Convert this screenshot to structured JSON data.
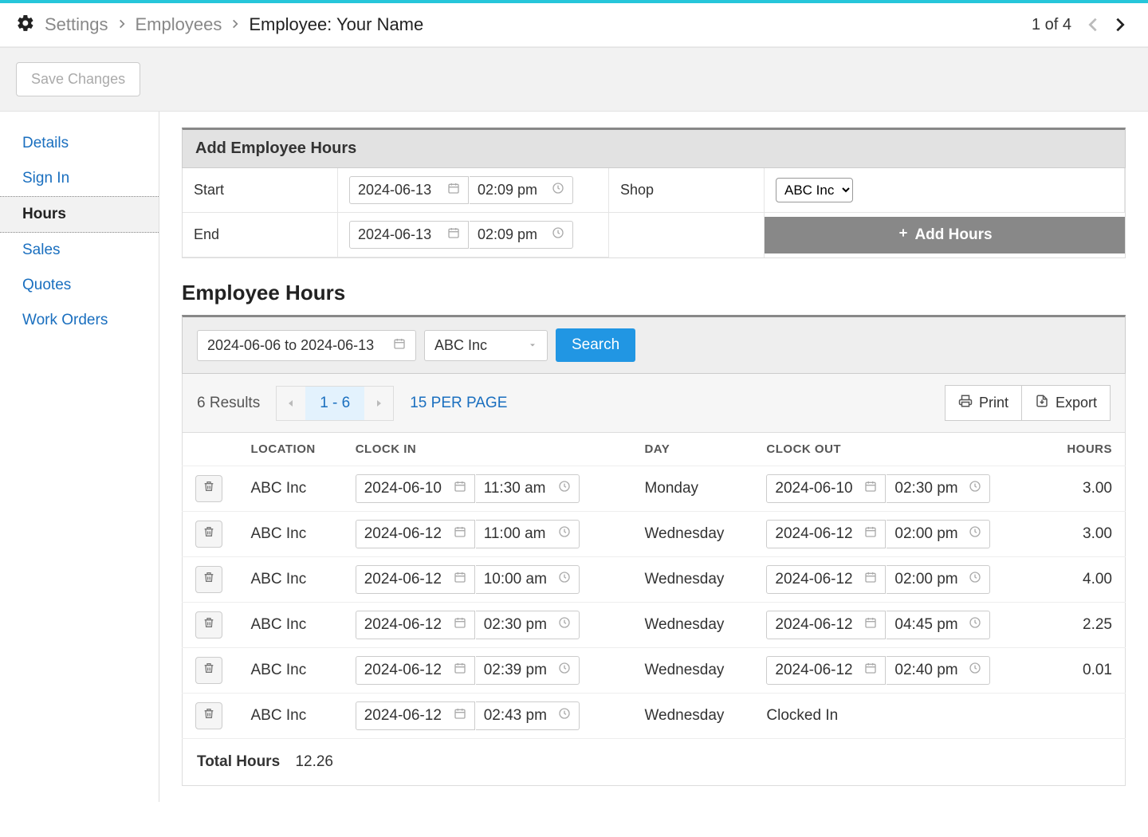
{
  "breadcrumb": {
    "level1": "Settings",
    "level2": "Employees",
    "level3": "Employee:  Your Name",
    "pager": "1 of 4"
  },
  "actions": {
    "save": "Save Changes"
  },
  "sidebar": {
    "items": [
      {
        "label": "Details"
      },
      {
        "label": "Sign In"
      },
      {
        "label": "Hours"
      },
      {
        "label": "Sales"
      },
      {
        "label": "Quotes"
      },
      {
        "label": "Work Orders"
      }
    ]
  },
  "addHours": {
    "title": "Add Employee Hours",
    "startLabel": "Start",
    "endLabel": "End",
    "startDate": "2024-06-13",
    "startTime": "02:09 pm",
    "endDate": "2024-06-13",
    "endTime": "02:09 pm",
    "shopLabel": "Shop",
    "shopValue": "ABC Inc",
    "addButton": "Add Hours"
  },
  "listing": {
    "heading": "Employee Hours",
    "filterDateRange": "2024-06-06 to 2024-06-13",
    "filterShop": "ABC Inc",
    "searchLabel": "Search",
    "resultsCount": "6 Results",
    "pageRange": "1 - 6",
    "perPage": "15 PER PAGE",
    "printLabel": "Print",
    "exportLabel": "Export",
    "columns": {
      "location": "LOCATION",
      "clockin": "CLOCK IN",
      "day": "DAY",
      "clockout": "CLOCK OUT",
      "hours": "HOURS"
    },
    "rows": [
      {
        "location": "ABC Inc",
        "inDate": "2024-06-10",
        "inTime": "11:30 am",
        "day": "Monday",
        "outDate": "2024-06-10",
        "outTime": "02:30 pm",
        "hours": "3.00"
      },
      {
        "location": "ABC Inc",
        "inDate": "2024-06-12",
        "inTime": "11:00 am",
        "day": "Wednesday",
        "outDate": "2024-06-12",
        "outTime": "02:00 pm",
        "hours": "3.00"
      },
      {
        "location": "ABC Inc",
        "inDate": "2024-06-12",
        "inTime": "10:00 am",
        "day": "Wednesday",
        "outDate": "2024-06-12",
        "outTime": "02:00 pm",
        "hours": "4.00"
      },
      {
        "location": "ABC Inc",
        "inDate": "2024-06-12",
        "inTime": "02:30 pm",
        "day": "Wednesday",
        "outDate": "2024-06-12",
        "outTime": "04:45 pm",
        "hours": "2.25"
      },
      {
        "location": "ABC Inc",
        "inDate": "2024-06-12",
        "inTime": "02:39 pm",
        "day": "Wednesday",
        "outDate": "2024-06-12",
        "outTime": "02:40 pm",
        "hours": "0.01"
      },
      {
        "location": "ABC Inc",
        "inDate": "2024-06-12",
        "inTime": "02:43 pm",
        "day": "Wednesday",
        "outDate": "",
        "outTime": "",
        "hours": "",
        "clockedIn": "Clocked In"
      }
    ],
    "totalLabel": "Total Hours",
    "totalValue": "12.26"
  }
}
